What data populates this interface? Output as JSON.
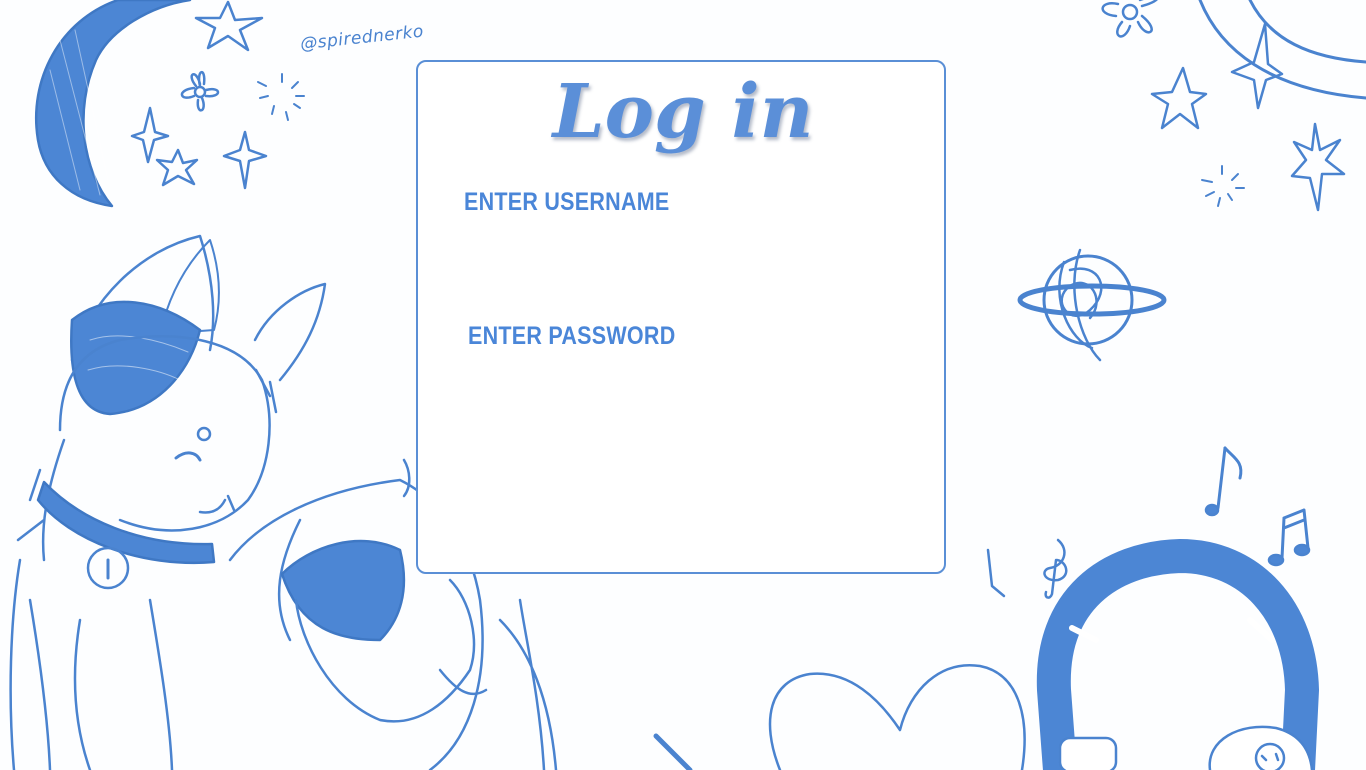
{
  "watermark": "@spirednerko",
  "login": {
    "title": "Log in",
    "username_label": "ENTER USERNAME",
    "password_label": "ENTER PASSWORD",
    "username_value": "",
    "password_value": ""
  },
  "colors": {
    "accent": "#5b8fd8",
    "line": "#4a83cf",
    "fill": "#4c86d4"
  },
  "icons": [
    "moon-icon",
    "star-icon",
    "flower-icon",
    "sparkle-icon",
    "planet-icon",
    "music-note-icon",
    "treble-clef-icon",
    "headphones-icon",
    "heart-icon",
    "cat-illustration"
  ]
}
